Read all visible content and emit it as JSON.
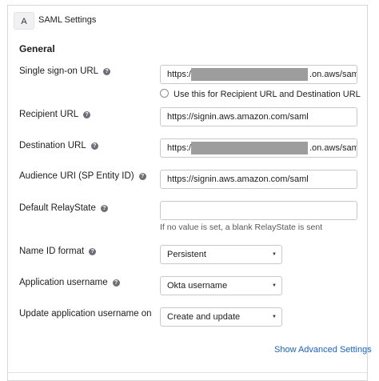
{
  "panel": {
    "badge": "A",
    "title": "SAML Settings"
  },
  "section": {
    "title": "General"
  },
  "fields": {
    "sso_url": {
      "label": "Single sign-on URL",
      "prefix": "https://",
      "suffix": ".on.aws/saml",
      "checkbox_label": "Use this for Recipient URL and Destination URL",
      "checkbox_checked": false
    },
    "recipient_url": {
      "label": "Recipient URL",
      "value": "https://signin.aws.amazon.com/saml"
    },
    "destination_url": {
      "label": "Destination URL",
      "prefix": "https://",
      "suffix": ".on.aws/saml"
    },
    "audience_uri": {
      "label": "Audience URI (SP Entity ID)",
      "value": "https://signin.aws.amazon.com/saml"
    },
    "relay_state": {
      "label": "Default RelayState",
      "value": "",
      "hint": "If no value is set, a blank RelayState is sent"
    },
    "name_id_format": {
      "label": "Name ID format",
      "selected": "Persistent"
    },
    "app_username": {
      "label": "Application username",
      "selected": "Okta username"
    },
    "update_username": {
      "label": "Update application username on",
      "selected": "Create and update"
    }
  },
  "links": {
    "advanced": "Show Advanced Settings"
  },
  "icons": {
    "help": "help-icon",
    "dropdown": "chevron-down-icon"
  },
  "colors": {
    "link": "#1662dd",
    "border": "#c8c8cf",
    "redaction": "#9d9d9d"
  }
}
